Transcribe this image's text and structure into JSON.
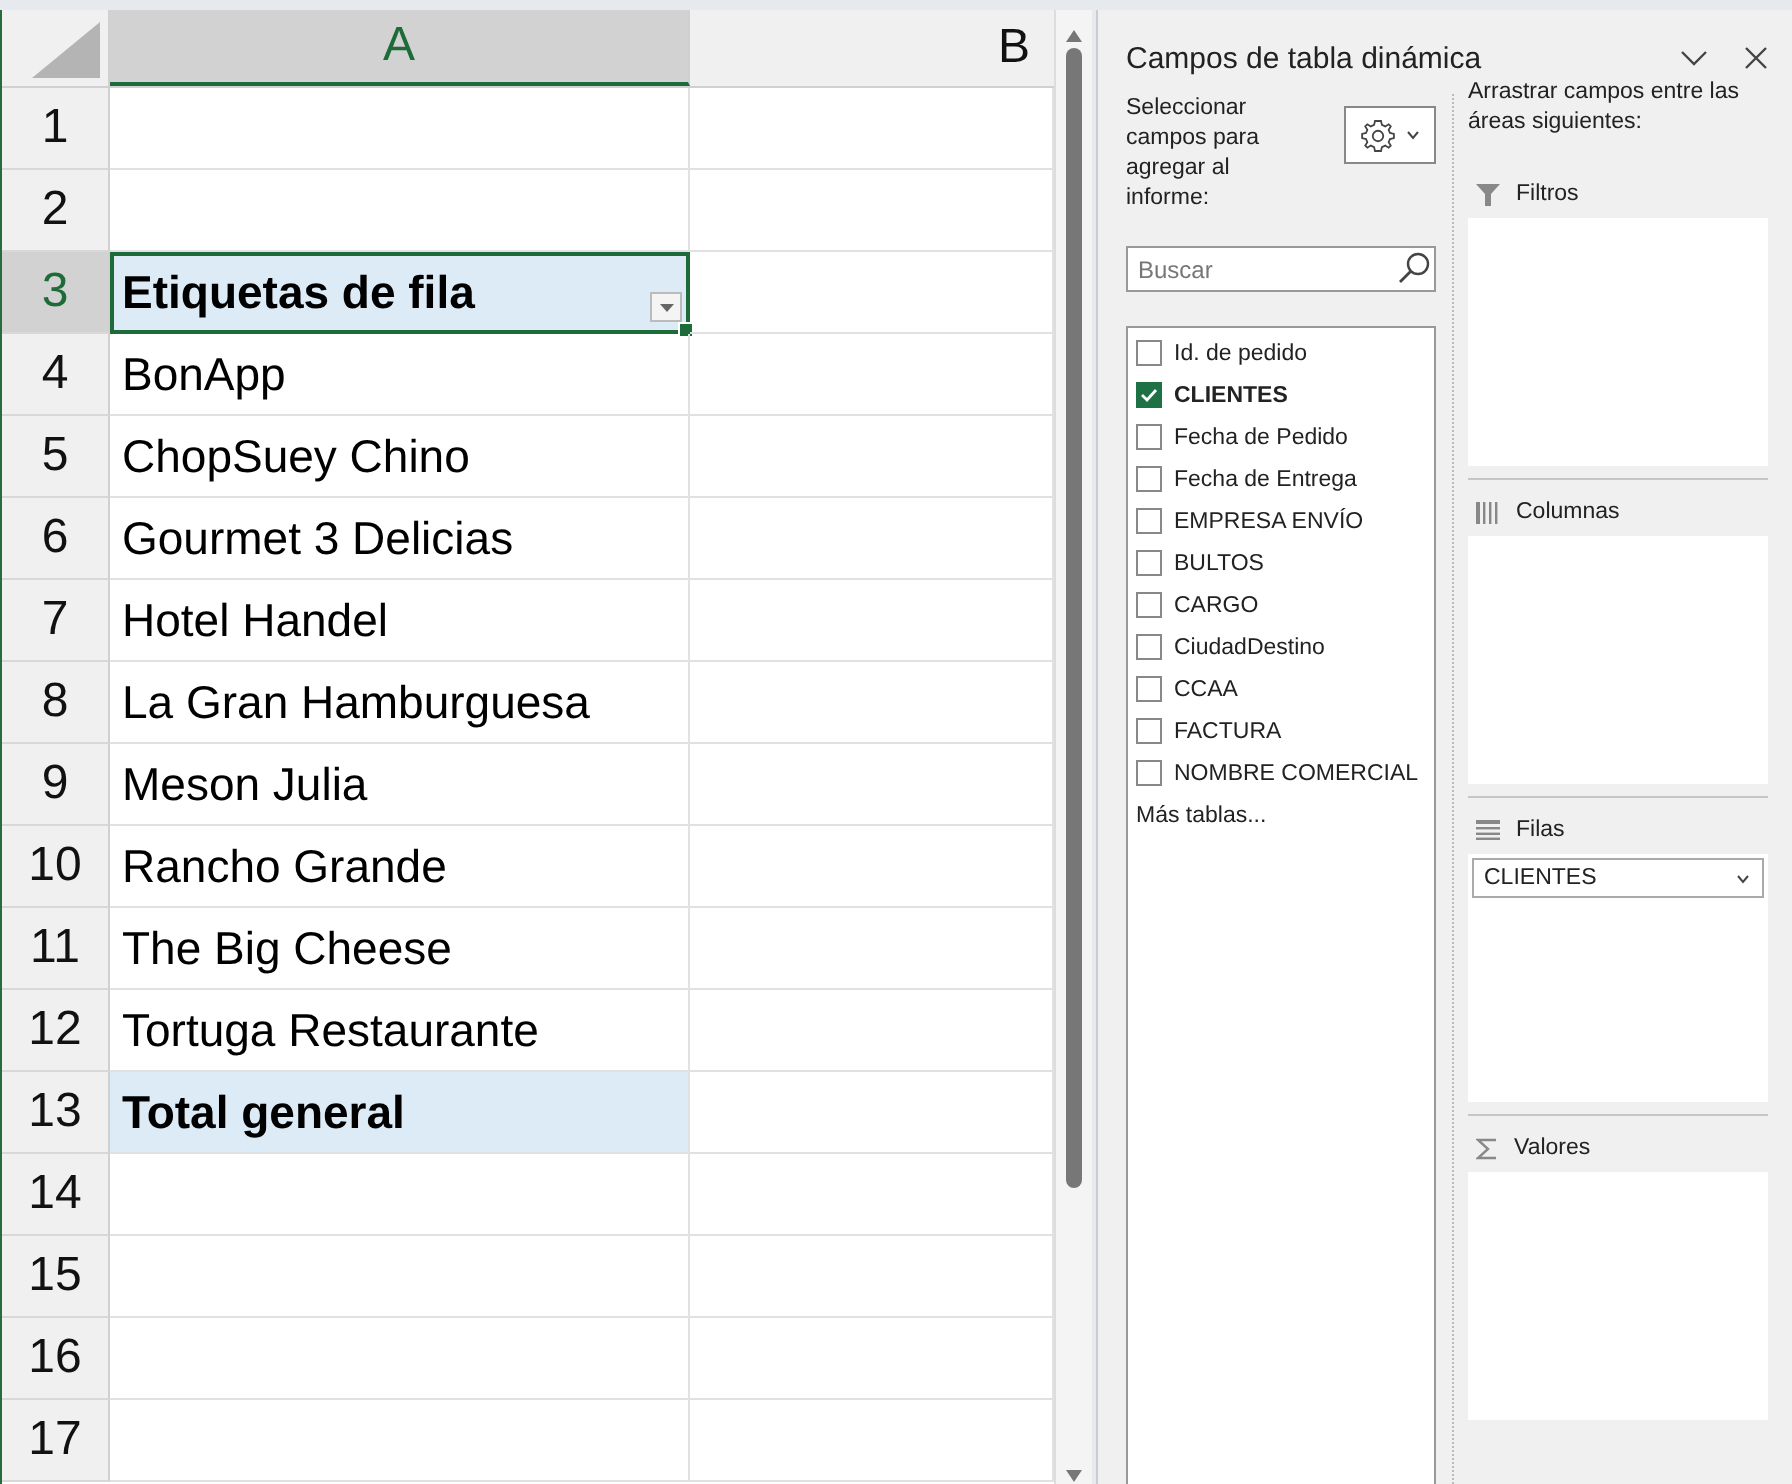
{
  "sheet": {
    "columns": [
      {
        "label": "A",
        "selected": true
      },
      {
        "label": "B",
        "selected": false
      }
    ],
    "rows": [
      {
        "number": "1",
        "selected": false,
        "kind": "blank"
      },
      {
        "number": "2",
        "selected": false,
        "kind": "blank"
      },
      {
        "number": "3",
        "selected": true,
        "kind": "header",
        "value": "Etiquetas de fila"
      },
      {
        "number": "4",
        "selected": false,
        "kind": "item",
        "value": "BonApp"
      },
      {
        "number": "5",
        "selected": false,
        "kind": "item",
        "value": "ChopSuey Chino"
      },
      {
        "number": "6",
        "selected": false,
        "kind": "item",
        "value": "Gourmet 3 Delicias"
      },
      {
        "number": "7",
        "selected": false,
        "kind": "item",
        "value": "Hotel Handel"
      },
      {
        "number": "8",
        "selected": false,
        "kind": "item",
        "value": "La Gran Hamburguesa"
      },
      {
        "number": "9",
        "selected": false,
        "kind": "item",
        "value": "Meson Julia"
      },
      {
        "number": "10",
        "selected": false,
        "kind": "item",
        "value": "Rancho Grande"
      },
      {
        "number": "11",
        "selected": false,
        "kind": "item",
        "value": "The Big Cheese"
      },
      {
        "number": "12",
        "selected": false,
        "kind": "item",
        "value": "Tortuga Restaurante"
      },
      {
        "number": "13",
        "selected": false,
        "kind": "total",
        "value": "Total general"
      },
      {
        "number": "14",
        "selected": false,
        "kind": "blank"
      },
      {
        "number": "15",
        "selected": false,
        "kind": "blank"
      },
      {
        "number": "16",
        "selected": false,
        "kind": "blank"
      },
      {
        "number": "17",
        "selected": false,
        "kind": "blank"
      }
    ]
  },
  "pivot_panel": {
    "title": "Campos de tabla dinámica",
    "fields_label": "Seleccionar campos para agregar al informe:",
    "search": {
      "placeholder": "Buscar"
    },
    "fields": [
      {
        "label": "Id. de pedido",
        "checked": false
      },
      {
        "label": "CLIENTES",
        "checked": true
      },
      {
        "label": "Fecha de Pedido",
        "checked": false
      },
      {
        "label": "Fecha de Entrega",
        "checked": false
      },
      {
        "label": "EMPRESA ENVÍO",
        "checked": false
      },
      {
        "label": "BULTOS",
        "checked": false
      },
      {
        "label": "CARGO",
        "checked": false
      },
      {
        "label": "CiudadDestino",
        "checked": false
      },
      {
        "label": "CCAA",
        "checked": false
      },
      {
        "label": "FACTURA",
        "checked": false
      },
      {
        "label": "NOMBRE COMERCIAL",
        "checked": false
      }
    ],
    "more_tables": "Más tablas...",
    "areas_hint": "Arrastrar campos entre las áreas siguientes:",
    "areas": [
      {
        "kind": "filters",
        "label": "Filtros"
      },
      {
        "kind": "columns",
        "label": "Columnas"
      },
      {
        "kind": "rows",
        "label": "Filas",
        "items": [
          "CLIENTES"
        ]
      },
      {
        "kind": "values",
        "label": "Valores"
      }
    ]
  }
}
